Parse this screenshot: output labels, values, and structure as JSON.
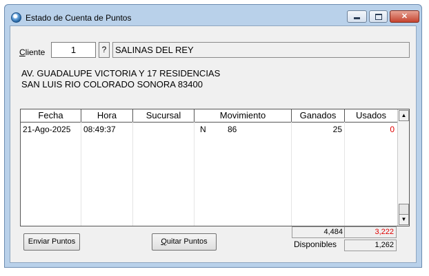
{
  "window": {
    "title": "Estado de Cuenta de Puntos"
  },
  "controls": {
    "minimize": "",
    "maximize": "",
    "close": "✕"
  },
  "client": {
    "label_prefix": "C",
    "label_rest": "liente",
    "number": "1",
    "lookup_button": "?",
    "name": "SALINAS DEL REY",
    "address_line1": "AV. GUADALUPE VICTORIA Y 17  RESIDENCIAS",
    "address_line2": "SAN LUIS RIO COLORADO SONORA 83400"
  },
  "table": {
    "columns": [
      "Fecha",
      "Hora",
      "Sucursal",
      "Movimiento",
      "Ganados",
      "Usados"
    ],
    "rows": [
      {
        "fecha": "21-Ago-2025",
        "hora": "08:49:37",
        "sucursal": "",
        "mov_tipo": "N",
        "mov_num": "86",
        "ganados": "25",
        "usados": "0"
      }
    ]
  },
  "totals": {
    "ganados": "4,484",
    "usados": "3,222",
    "disponibles_label": "Disponibles",
    "disponibles": "1,262"
  },
  "buttons": {
    "enviar": "Enviar Puntos",
    "quitar_prefix": "Q",
    "quitar_rest": "uitar Puntos"
  },
  "colors": {
    "usados_red": "#e00000",
    "titlebar": "#b9d1ea"
  }
}
